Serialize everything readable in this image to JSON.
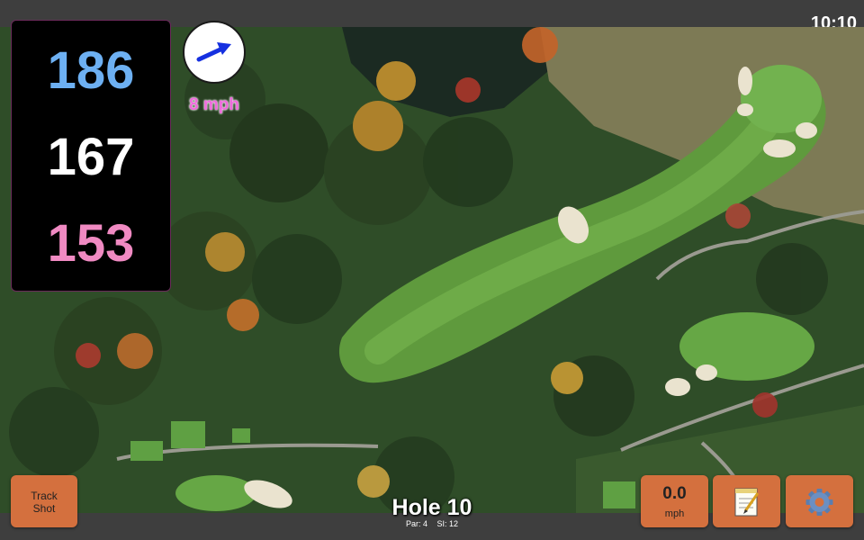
{
  "status": {
    "time": "10:10"
  },
  "yardage": {
    "back": "186",
    "middle": "167",
    "front": "153"
  },
  "wind": {
    "speed_label": "8 mph"
  },
  "buttons": {
    "track_shot": {
      "line1": "Track",
      "line2": "Shot"
    },
    "speed": {
      "value": "0.0",
      "unit": "mph"
    },
    "notes_icon": "notepad-icon",
    "settings_icon": "gear-icon"
  },
  "hole": {
    "title": "Hole 10",
    "par": "Par: 4",
    "si": "SI: 12"
  },
  "colors": {
    "back_yardage": "#6db0f2",
    "middle_yardage": "#ffffff",
    "front_yardage": "#f08ac2",
    "button": "#d4703e",
    "wind_label": "#f06adc"
  }
}
